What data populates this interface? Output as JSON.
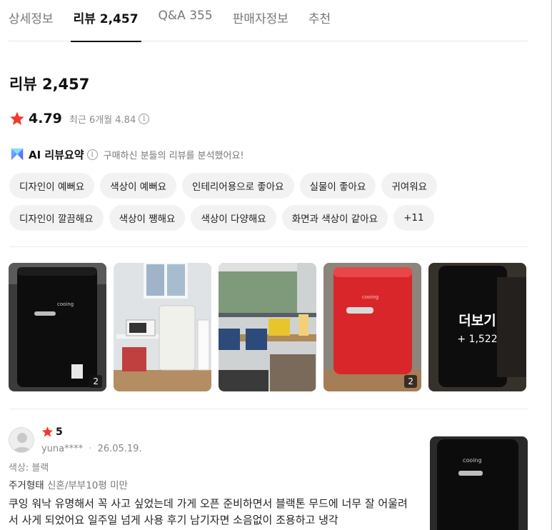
{
  "tabs": [
    {
      "label": "상세정보"
    },
    {
      "label": "리뷰 2,457"
    },
    {
      "label": "Q&A 355"
    },
    {
      "label": "판매자정보"
    },
    {
      "label": "추천"
    }
  ],
  "title": "리뷰 2,457",
  "rating": {
    "score": "4.79",
    "recent": "최근 6개월 4.84",
    "star_color": "#f03a2e"
  },
  "ai_summary": {
    "label": "AI 리뷰요약",
    "description": "구매하신 분들의 리뷰를 분석했어요!"
  },
  "chips_row1": [
    "디자인이 예뻐요",
    "색상이 예뻐요",
    "인테리어용으로 좋아요",
    "실물이 좋아요",
    "귀여워요"
  ],
  "chips_row2": [
    "디자인이 깔끔해요",
    "색상이 쨍해요",
    "색상이 다양해요",
    "화면과 색상이 같아요",
    "+11"
  ],
  "photos": {
    "badge1": "2",
    "badge4": "2",
    "more_label": "더보기",
    "more_count": "+ 1,522",
    "logo_text": "cooing"
  },
  "review": {
    "stars": "5",
    "author": "yuna****",
    "date": "26.05.19.",
    "option": "색상: 블랙",
    "housing_label": "주거형태",
    "housing_value": "신혼/부부10평 미만",
    "body": "쿠잉 워낙 유명해서 꼭 사고 싶었는데 가게 오픈 준비하면서 블랙톤 무드에 너무 잘 어울려서 사게 되었어요 일주일 넘게 사용 후기 남기자면 소음없이 조용하고 냉각"
  }
}
